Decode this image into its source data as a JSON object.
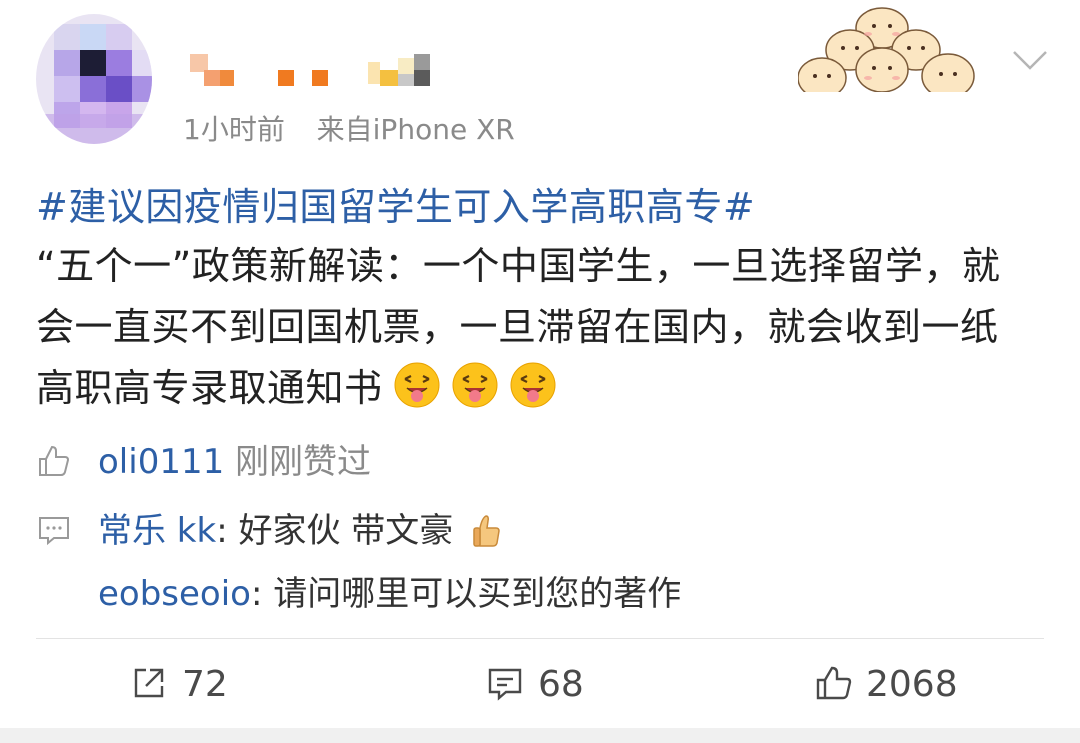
{
  "post": {
    "meta": {
      "time": "1小时前",
      "source_prefix": "来自",
      "device": "iPhone XR"
    },
    "hashtag": "#建议因疫情归国留学生可入学高职高专#",
    "body": "“五个一”政策新解读：一个中国学生，一旦选择留学，就会一直买不到回国机票，一旦滞留在国内，就会收到一纸高职高专录取通知书",
    "emojis": [
      "tongue-out-emoji",
      "tongue-out-emoji",
      "tongue-out-emoji"
    ]
  },
  "likes_line": {
    "user": "oli0111",
    "text": "刚刚赞过"
  },
  "comments": [
    {
      "user": "常乐 kk",
      "sep": ": ",
      "text": "好家伙 带文豪"
    },
    {
      "user": "eobseoio",
      "sep": ": ",
      "text": "请问哪里可以买到您的著作"
    }
  ],
  "actions": {
    "share_count": "72",
    "comment_count": "68",
    "like_count": "2068"
  },
  "colors": {
    "link": "#2d5fa6",
    "meta": "#8a8a8a",
    "text": "#222222"
  }
}
